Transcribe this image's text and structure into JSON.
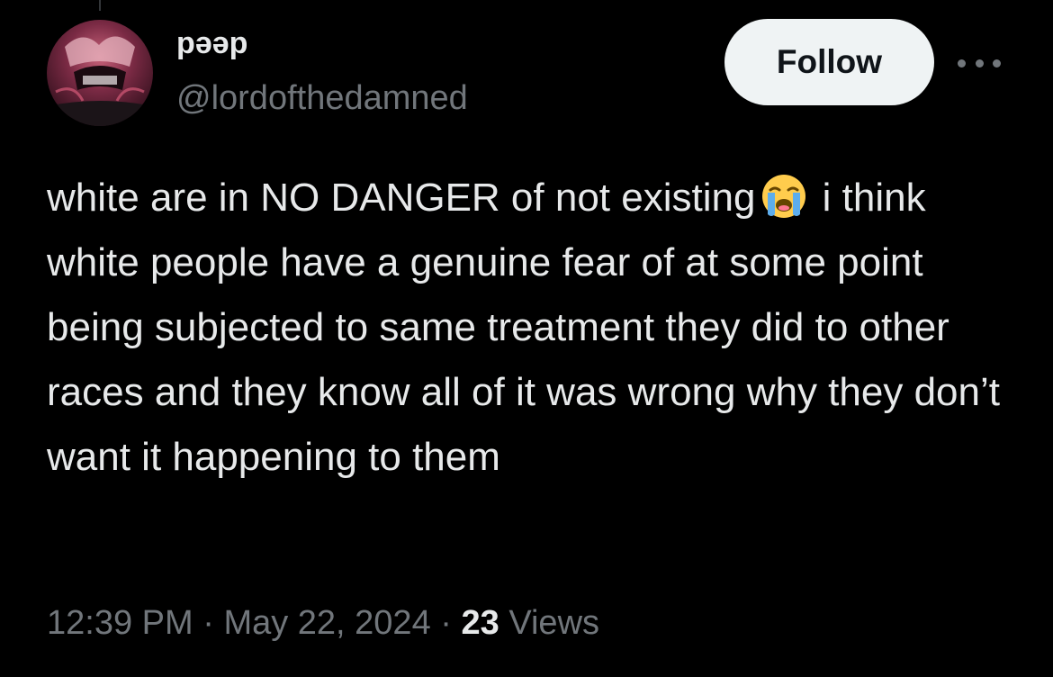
{
  "author": {
    "display_name": "pəəp",
    "handle": "@lordofthedamned",
    "avatar_icon": "avatar-image"
  },
  "actions": {
    "follow_label": "Follow",
    "more_icon": "more-horizontal-icon"
  },
  "tweet": {
    "text_before_emoji": "white are in NO DANGER of not existing",
    "emoji": "loudly-crying-face-emoji",
    "text_after_emoji": "i think white people have a genuine fear of at some point being subjected to same treatment they did to other races and they know all of it was wrong why they don’t want it happening to them"
  },
  "meta": {
    "time": "12:39 PM",
    "separator": "·",
    "date": "May 22, 2024",
    "views_count": "23",
    "views_label": "Views"
  },
  "colors": {
    "background": "#000000",
    "text_primary": "#e7e9ea",
    "text_secondary": "#71767b",
    "follow_bg": "#eff3f4",
    "follow_text": "#0f1419"
  }
}
